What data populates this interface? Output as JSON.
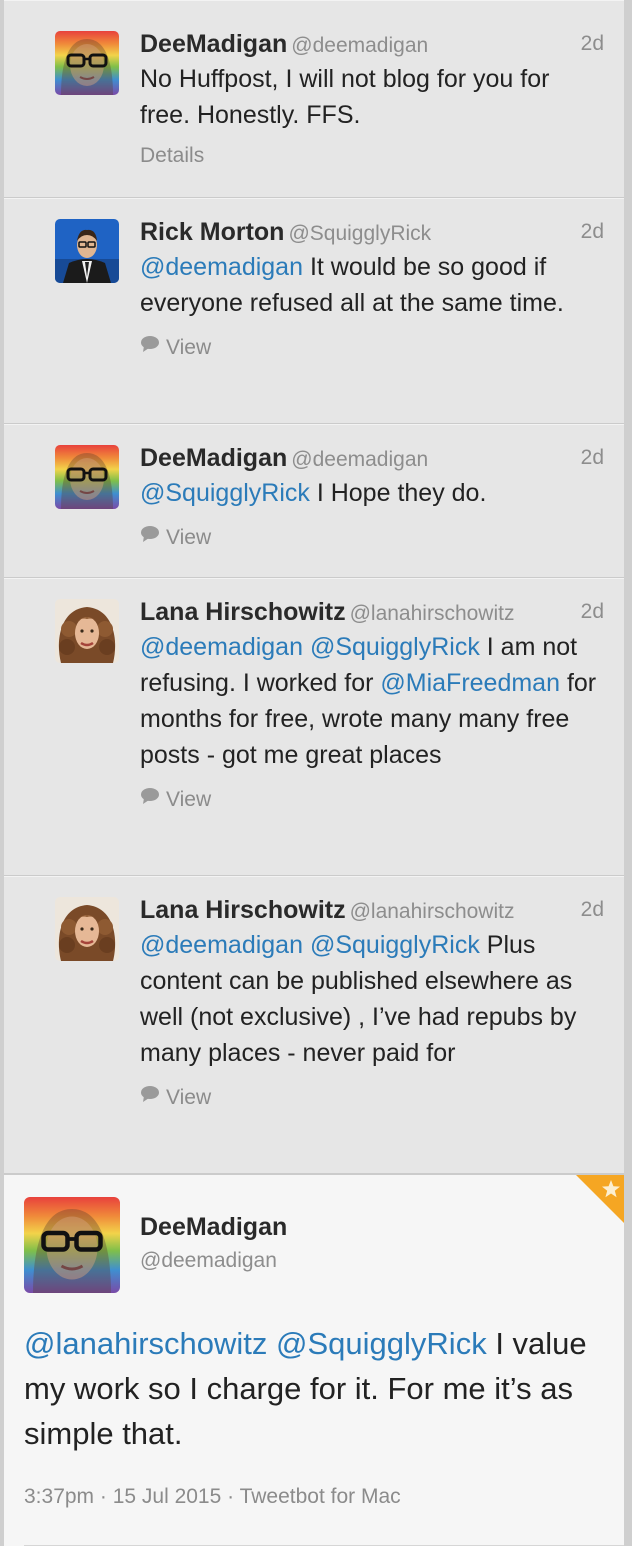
{
  "colors": {
    "mention": "#2b7bb9",
    "ribbon": "#f5a623"
  },
  "tweets": [
    {
      "name": "DeeMadigan",
      "handle": "@deemadigan",
      "time": "2d",
      "avatar": "rainbow-avatar",
      "segments": [
        {
          "t": "No Huffpost, I will not blog for you for free. Honestly. FFS.",
          "m": false
        }
      ],
      "action": {
        "icon": "",
        "label": "Details"
      }
    },
    {
      "name": "Rick Morton",
      "handle": "@SquigglyRick",
      "time": "2d",
      "avatar": "suit-avatar",
      "segments": [
        {
          "t": "@deemadigan",
          "m": true
        },
        {
          "t": " It would be so good if everyone refused all at the same time.",
          "m": false
        }
      ],
      "action": {
        "icon": "speech-bubble-icon",
        "label": "View"
      }
    },
    {
      "name": "DeeMadigan",
      "handle": "@deemadigan",
      "time": "2d",
      "avatar": "rainbow-avatar",
      "segments": [
        {
          "t": "@SquigglyRick",
          "m": true
        },
        {
          "t": " I Hope they do.",
          "m": false
        }
      ],
      "action": {
        "icon": "speech-bubble-icon",
        "label": "View"
      }
    },
    {
      "name": "Lana Hirschowitz",
      "handle": "@lanahirschowitz",
      "time": "2d",
      "avatar": "curly-hair-avatar",
      "segments": [
        {
          "t": "@deemadigan",
          "m": true
        },
        {
          "t": " ",
          "m": false
        },
        {
          "t": "@SquigglyRick",
          "m": true
        },
        {
          "t": " I am not refusing. I worked for ",
          "m": false
        },
        {
          "t": "@MiaFreedman",
          "m": true
        },
        {
          "t": " for months for free, wrote many many free posts - got me great places",
          "m": false
        }
      ],
      "action": {
        "icon": "speech-bubble-icon",
        "label": "View"
      }
    },
    {
      "name": "Lana Hirschowitz",
      "handle": "@lanahirschowitz",
      "time": "2d",
      "avatar": "curly-hair-avatar",
      "segments": [
        {
          "t": "@deemadigan",
          "m": true
        },
        {
          "t": " ",
          "m": false
        },
        {
          "t": "@SquigglyRick",
          "m": true
        },
        {
          "t": " Plus content can be published elsewhere as well (not exclusive) , I’ve had repubs by many places - never paid for",
          "m": false
        }
      ],
      "action": {
        "icon": "speech-bubble-icon",
        "label": "View"
      }
    }
  ],
  "focus": {
    "name": "DeeMadigan",
    "handle": "@deemadigan",
    "avatar": "rainbow-avatar",
    "ribbon_icon": "star-icon",
    "segments": [
      {
        "t": "@lanahirschowitz",
        "m": true
      },
      {
        "t": " ",
        "m": false
      },
      {
        "t": "@SquigglyRick",
        "m": true
      },
      {
        "t": " I value my work so I charge for it. For me it’s as simple that.",
        "m": false
      }
    ],
    "footer": "3:37pm · 15 Jul 2015 · Tweetbot for Mac"
  }
}
